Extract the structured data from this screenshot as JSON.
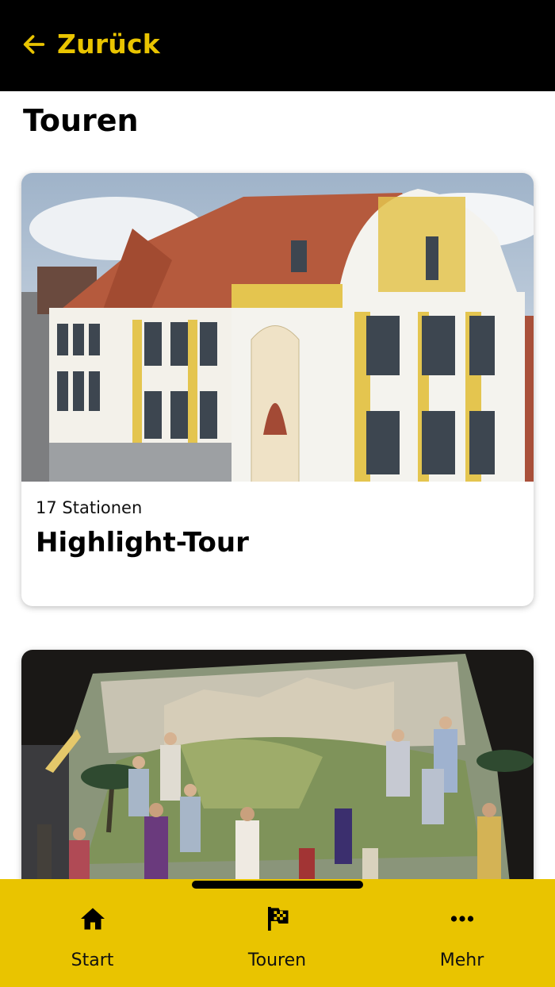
{
  "header": {
    "back_label": "Zurück"
  },
  "page": {
    "title": "Touren"
  },
  "tours": [
    {
      "stations": "17 Stationen",
      "title": "Highlight-Tour"
    }
  ],
  "tabbar": {
    "items": [
      {
        "label": "Start",
        "icon": "home-icon"
      },
      {
        "label": "Touren",
        "icon": "flag-icon"
      },
      {
        "label": "Mehr",
        "icon": "more-icon"
      }
    ]
  },
  "colors": {
    "accent": "#e9c400",
    "header_bg": "#000000"
  }
}
